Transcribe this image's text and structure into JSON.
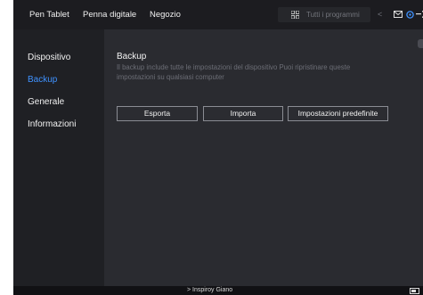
{
  "topnav": {
    "items": [
      "Pen Tablet",
      "Penna digitale",
      "Negozio"
    ]
  },
  "search": {
    "placeholder": "Tutti i programmi",
    "back": "<"
  },
  "window_icons": [
    "mail-icon",
    "settings-icon",
    "minimize-icon",
    "close-icon"
  ],
  "sidebar": {
    "items": [
      {
        "label": "Dispositivo",
        "active": false
      },
      {
        "label": "Backup",
        "active": true
      },
      {
        "label": "Generale",
        "active": false
      },
      {
        "label": "Informazioni",
        "active": false
      }
    ]
  },
  "content": {
    "title": "Backup",
    "description": "Il backup include tutte le impostazioni del dispositivo Puoi ripristinare queste impostazioni su qualsiasi computer",
    "buttons": {
      "export": "Esporta",
      "import": "Importa",
      "defaults": "Impostazioni predefinite"
    }
  },
  "statusbar": {
    "device": "> Inspiroy Giano"
  },
  "colors": {
    "accent": "#3f92ff",
    "background": "#2a2b30",
    "sidebar": "#1f2024",
    "topbar": "#1c1c20"
  }
}
